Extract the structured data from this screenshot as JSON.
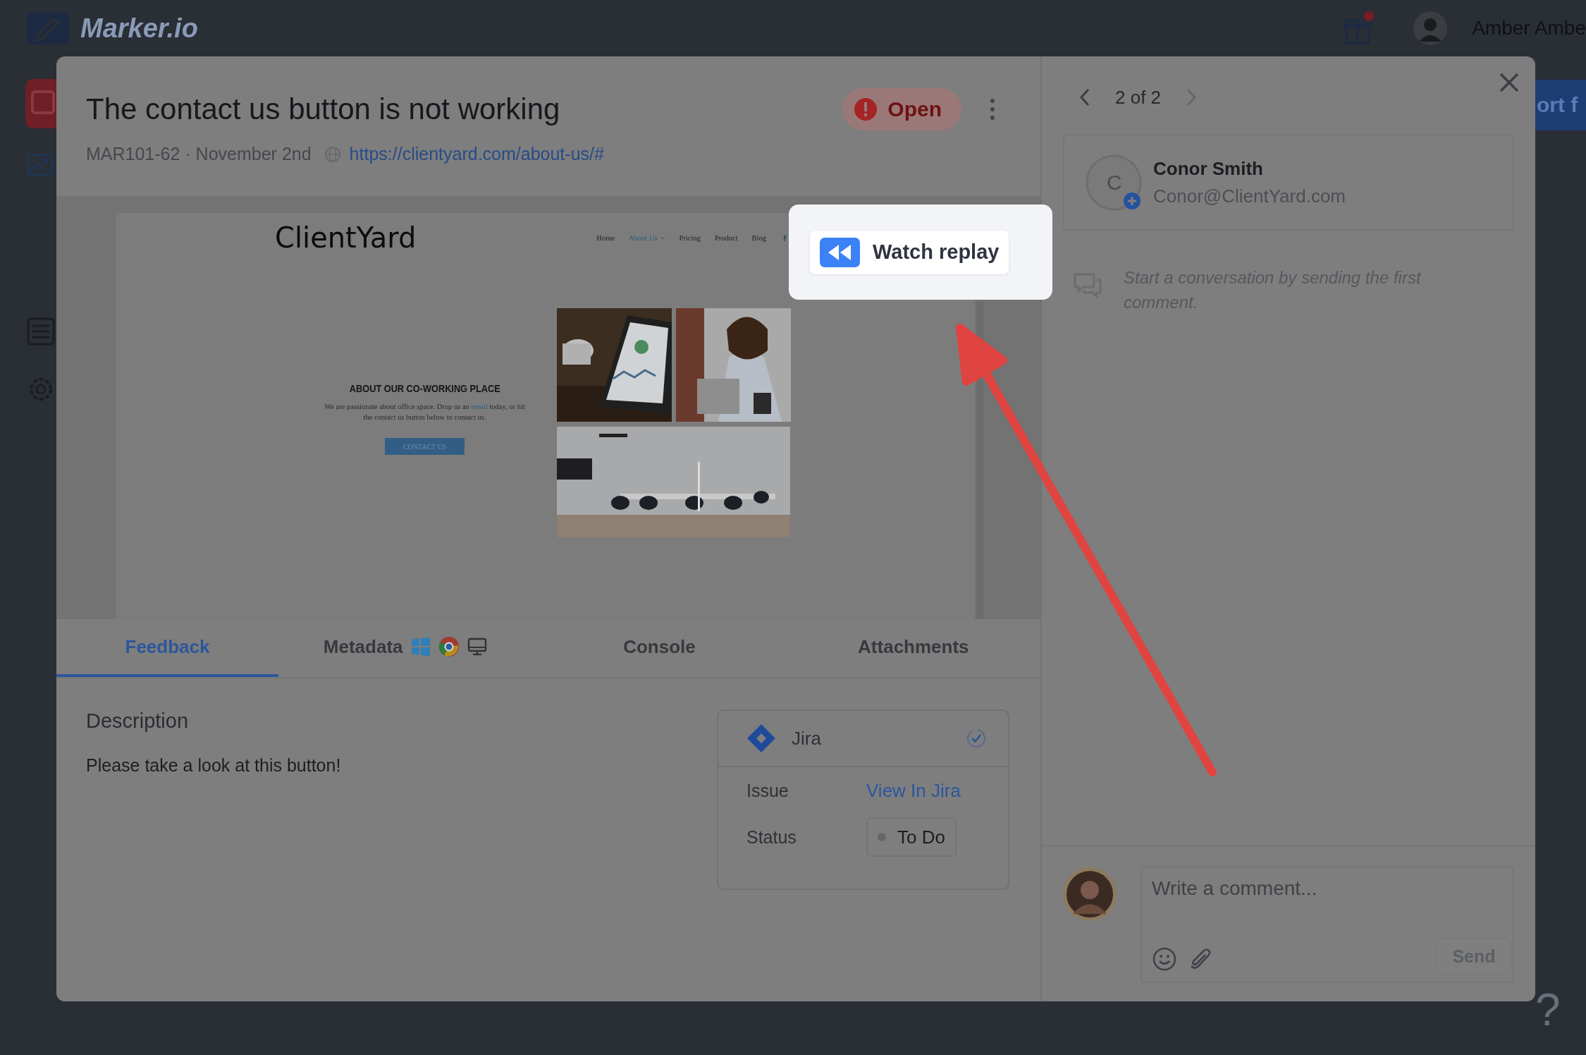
{
  "app_bar": {
    "logo_text": "Marker.io",
    "user_name": "Amber Ambe"
  },
  "background": {
    "button_text": "ort f",
    "help_text": "?"
  },
  "issue": {
    "title": "The contact us button is not working",
    "status": {
      "label": "Open"
    },
    "meta": "MAR101-62 · November 2nd",
    "url": "https://clientyard.com/about-us/#"
  },
  "screenshot": {
    "site_name": "ClientYard",
    "nav": [
      {
        "label": "Home",
        "selected": false
      },
      {
        "label": "About Us",
        "selected": true
      },
      {
        "label": "Pricing",
        "selected": false
      },
      {
        "label": "Product",
        "selected": false
      },
      {
        "label": "Blog",
        "selected": false
      }
    ],
    "heading": "ABOUT OUR CO-WORKING PLACE",
    "text_before": "We are passionate about office space. Drop us an",
    "link": "email",
    "text_after": "today, or hit the contact us button below to contact us.",
    "button": "CONTACT US",
    "replay_button": "Watch replay"
  },
  "tabs": [
    {
      "label": "Feedback",
      "selected": true
    },
    {
      "label": "Metadata",
      "selected": false
    },
    {
      "label": "Console",
      "selected": false
    },
    {
      "label": "Attachments",
      "selected": false
    }
  ],
  "description": {
    "heading": "Description",
    "text": "Please take a look at this button!"
  },
  "integration": {
    "name": "Jira",
    "rows": [
      {
        "label": "Issue",
        "value": "View In Jira",
        "kind": "link"
      },
      {
        "label": "Status",
        "value": "To Do",
        "kind": "status"
      }
    ]
  },
  "pager": {
    "text": "2 of 2"
  },
  "reporter": {
    "initial": "C",
    "name": "Conor Smith",
    "email": "Conor@ClientYard.com"
  },
  "conversation": {
    "empty_text": "Start a conversation by sending the first comment."
  },
  "comment": {
    "placeholder": "Write a comment...",
    "send": "Send"
  }
}
